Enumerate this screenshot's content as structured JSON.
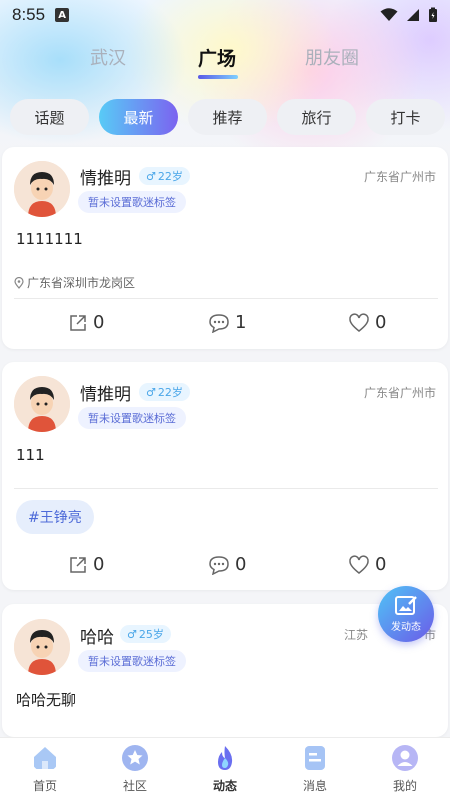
{
  "status": {
    "time": "8:55",
    "a_icon": "A"
  },
  "city_tabs": [
    {
      "label": "武汉",
      "active": false
    },
    {
      "label": "广场",
      "active": true
    },
    {
      "label": "朋友圈",
      "active": false
    }
  ],
  "chips": [
    {
      "label": "话题",
      "active": false
    },
    {
      "label": "最新",
      "active": true
    },
    {
      "label": "推荐",
      "active": false
    },
    {
      "label": "旅行",
      "active": false
    },
    {
      "label": "打卡",
      "active": false
    }
  ],
  "posts": [
    {
      "name": "情推明",
      "gender_icon": "male-icon",
      "age": "22岁",
      "music_tag": "暂未设置歌迷标签",
      "location_right": "广东省广州市",
      "text": "1111111",
      "post_location": "广东省深圳市龙岗区",
      "shares": "0",
      "comments": "1",
      "likes": "0"
    },
    {
      "name": "情推明",
      "gender_icon": "male-icon",
      "age": "22岁",
      "music_tag": "暂未设置歌迷标签",
      "location_right": "广东省广州市",
      "text": "111",
      "topic": "#王铮亮",
      "shares": "0",
      "comments": "0",
      "likes": "0"
    },
    {
      "name": "哈哈",
      "gender_icon": "male-icon",
      "age": "25岁",
      "music_tag": "暂未设置歌迷标签",
      "location_right": "江苏",
      "location_right_tail": "市",
      "text": "哈哈无聊"
    }
  ],
  "fab": {
    "label": "发动态"
  },
  "bottom_nav": [
    {
      "label": "首页",
      "icon": "home-icon",
      "color": "#a9c8f5"
    },
    {
      "label": "社区",
      "icon": "star-icon",
      "color": "#9fb5f0"
    },
    {
      "label": "动态",
      "icon": "flame-icon",
      "color": "#6a6ff0",
      "active": true
    },
    {
      "label": "消息",
      "icon": "message-icon",
      "color": "#a6c4f5"
    },
    {
      "label": "我的",
      "icon": "profile-icon",
      "color": "#b7b6f5"
    }
  ],
  "colors": {
    "accent_start": "#58cbf6",
    "accent_end": "#7b63f0"
  }
}
